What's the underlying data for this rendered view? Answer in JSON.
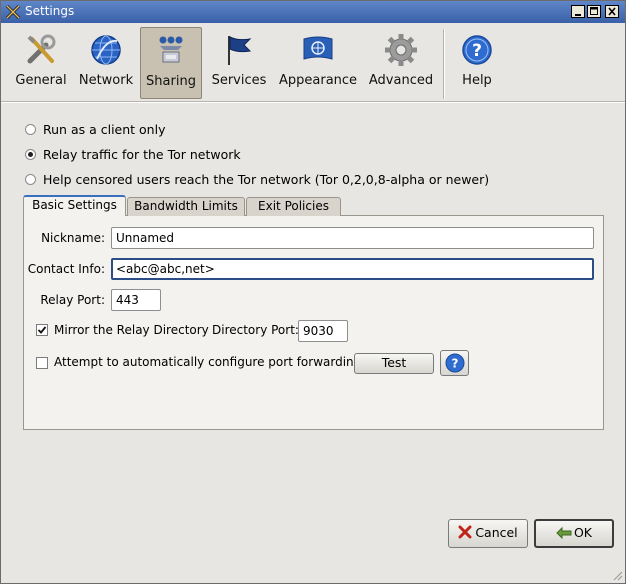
{
  "window": {
    "title": "Settings"
  },
  "toolbar": {
    "items": [
      {
        "label": "General",
        "icon": "tools-icon"
      },
      {
        "label": "Network",
        "icon": "network-globe-icon"
      },
      {
        "label": "Sharing",
        "icon": "sharing-icon",
        "active": true
      },
      {
        "label": "Services",
        "icon": "flag-icon"
      },
      {
        "label": "Appearance",
        "icon": "un-flag-icon"
      },
      {
        "label": "Advanced",
        "icon": "gear-icon"
      },
      {
        "label": "Help",
        "icon": "help-icon"
      }
    ]
  },
  "mode": {
    "options": [
      {
        "label": "Run as a client only",
        "selected": false
      },
      {
        "label": "Relay traffic for the Tor network",
        "selected": true
      },
      {
        "label": "Help censored users reach the Tor network (Tor 0,2,0,8-alpha or newer)",
        "selected": false
      }
    ]
  },
  "tabs": [
    {
      "label": "Basic Settings",
      "active": true
    },
    {
      "label": "Bandwidth Limits",
      "active": false
    },
    {
      "label": "Exit Policies",
      "active": false
    }
  ],
  "basic": {
    "nickname_label": "Nickname:",
    "nickname_value": "Unnamed",
    "contact_label": "Contact Info:",
    "contact_value": "<abc@abc,net>",
    "relay_port_label": "Relay Port:",
    "relay_port_value": "443",
    "mirror_label": "Mirror the Relay Directory",
    "mirror_checked": true,
    "dir_port_label": "Directory Port:",
    "dir_port_value": "9030",
    "upnp_label": "Attempt to automatically configure port forwarding",
    "upnp_checked": false,
    "test_label": "Test"
  },
  "footer": {
    "cancel_label": "Cancel",
    "ok_label": "OK"
  },
  "colors": {
    "titlebar": "#3a60a8",
    "focus_border": "#2b4e86",
    "tab_accent": "#3a6fc0"
  }
}
